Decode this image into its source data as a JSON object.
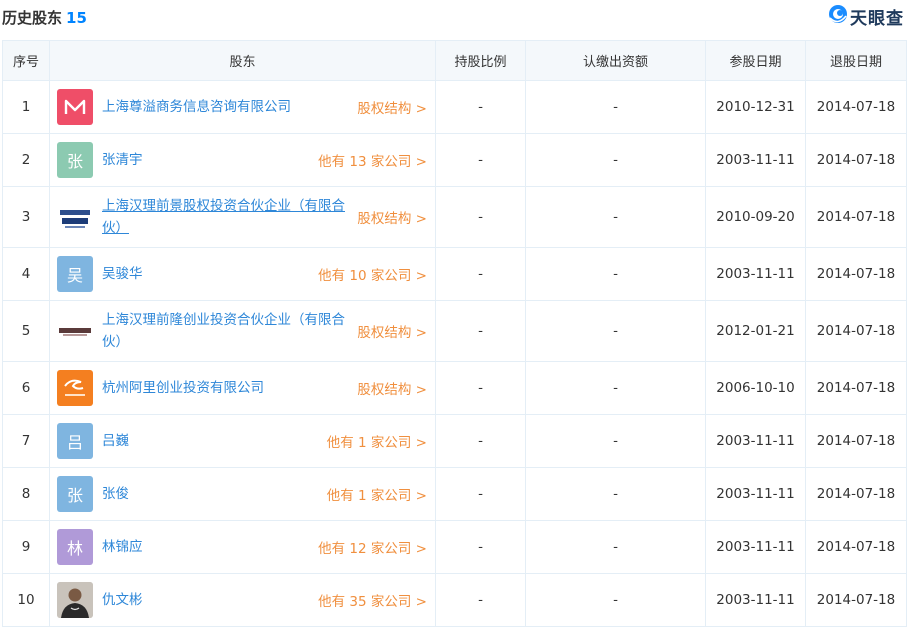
{
  "section": {
    "title": "历史股东",
    "count": "15"
  },
  "brand": {
    "name": "天眼查",
    "color": "#1f3a5c",
    "icon": "tianyancha-logo-icon"
  },
  "columns": [
    "序号",
    "股东",
    "持股比例",
    "认缴出资额",
    "参股日期",
    "退股日期"
  ],
  "rows": [
    {
      "index": "1",
      "avatar": {
        "type": "logo",
        "icon": "red-m-logo-icon",
        "color": "#ef4e68"
      },
      "name": "上海尊溢商务信息咨询有限公司",
      "underline": false,
      "link": "股权结构 >",
      "ratio": "-",
      "capital": "-",
      "join": "2010-12-31",
      "exit": "2014-07-18"
    },
    {
      "index": "2",
      "avatar": {
        "type": "char",
        "char": "张",
        "color": "#8ccab1"
      },
      "name": "张清宇",
      "underline": false,
      "link": "他有 13 家公司 >",
      "ratio": "-",
      "capital": "-",
      "join": "2003-11-11",
      "exit": "2014-07-18"
    },
    {
      "index": "3",
      "avatar": {
        "type": "logo",
        "icon": "new-access-logo-icon",
        "color": "#ffffff"
      },
      "name": "上海汉理前景股权投资合伙企业（有限合伙）",
      "underline": true,
      "link": "股权结构 >",
      "ratio": "-",
      "capital": "-",
      "join": "2010-09-20",
      "exit": "2014-07-18"
    },
    {
      "index": "4",
      "avatar": {
        "type": "char",
        "char": "吴",
        "color": "#7fb5e0"
      },
      "name": "吴骏华",
      "underline": false,
      "link": "他有 10 家公司 >",
      "ratio": "-",
      "capital": "-",
      "join": "2003-11-11",
      "exit": "2014-07-18"
    },
    {
      "index": "5",
      "avatar": {
        "type": "logo",
        "icon": "dark-strip-logo-icon",
        "color": "#ffffff"
      },
      "name": "上海汉理前隆创业投资合伙企业（有限合伙）",
      "underline": false,
      "link": "股权结构 >",
      "ratio": "-",
      "capital": "-",
      "join": "2012-01-21",
      "exit": "2014-07-18"
    },
    {
      "index": "6",
      "avatar": {
        "type": "logo",
        "icon": "alibaba-logo-icon",
        "color": "#f47f20"
      },
      "name": "杭州阿里创业投资有限公司",
      "underline": false,
      "link": "股权结构 >",
      "ratio": "-",
      "capital": "-",
      "join": "2006-10-10",
      "exit": "2014-07-18"
    },
    {
      "index": "7",
      "avatar": {
        "type": "char",
        "char": "吕",
        "color": "#7fb5e0"
      },
      "name": "吕巍",
      "underline": false,
      "link": "他有 1 家公司 >",
      "ratio": "-",
      "capital": "-",
      "join": "2003-11-11",
      "exit": "2014-07-18"
    },
    {
      "index": "8",
      "avatar": {
        "type": "char",
        "char": "张",
        "color": "#7fb5e0"
      },
      "name": "张俊",
      "underline": false,
      "link": "他有 1 家公司 >",
      "ratio": "-",
      "capital": "-",
      "join": "2003-11-11",
      "exit": "2014-07-18"
    },
    {
      "index": "9",
      "avatar": {
        "type": "char",
        "char": "林",
        "color": "#b09ad8"
      },
      "name": "林锦应",
      "underline": false,
      "link": "他有 12 家公司 >",
      "ratio": "-",
      "capital": "-",
      "join": "2003-11-11",
      "exit": "2014-07-18"
    },
    {
      "index": "10",
      "avatar": {
        "type": "photo",
        "icon": "person-photo-icon",
        "color": "#555555"
      },
      "name": "仇文彬",
      "underline": false,
      "link": "他有 35 家公司 >",
      "ratio": "-",
      "capital": "-",
      "join": "2003-11-11",
      "exit": "2014-07-18"
    }
  ]
}
